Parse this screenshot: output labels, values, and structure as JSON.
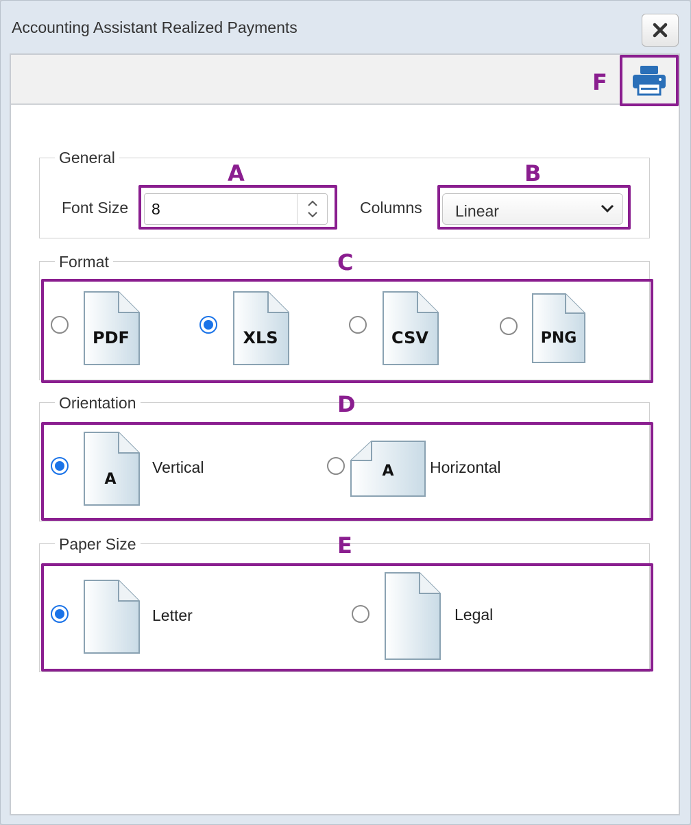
{
  "dialog": {
    "title": "Accounting Assistant Realized Payments",
    "close_icon": "close-icon",
    "print_icon": "printer-icon"
  },
  "annotations": {
    "a": "A",
    "b": "B",
    "c": "C",
    "d": "D",
    "e": "E",
    "f": "F",
    "color": "#8a1e8f"
  },
  "general": {
    "legend": "General",
    "font_size_label": "Font Size",
    "font_size_value": "8",
    "columns_label": "Columns",
    "columns_value": "Linear"
  },
  "format": {
    "legend": "Format",
    "options": [
      {
        "label": "PDF",
        "checked": false
      },
      {
        "label": "XLS",
        "checked": true
      },
      {
        "label": "CSV",
        "checked": false
      },
      {
        "label": "PNG",
        "checked": false
      }
    ]
  },
  "orientation": {
    "legend": "Orientation",
    "icon_letter": "A",
    "options": [
      {
        "label": "Vertical",
        "checked": true
      },
      {
        "label": "Horizontal",
        "checked": false
      }
    ]
  },
  "paper": {
    "legend": "Paper Size",
    "options": [
      {
        "label": "Letter",
        "checked": true
      },
      {
        "label": "Legal",
        "checked": false
      }
    ]
  },
  "colors": {
    "accent": "#1a73e8",
    "printer_blue": "#2a6fb8",
    "annotation": "#8a1e8f"
  }
}
